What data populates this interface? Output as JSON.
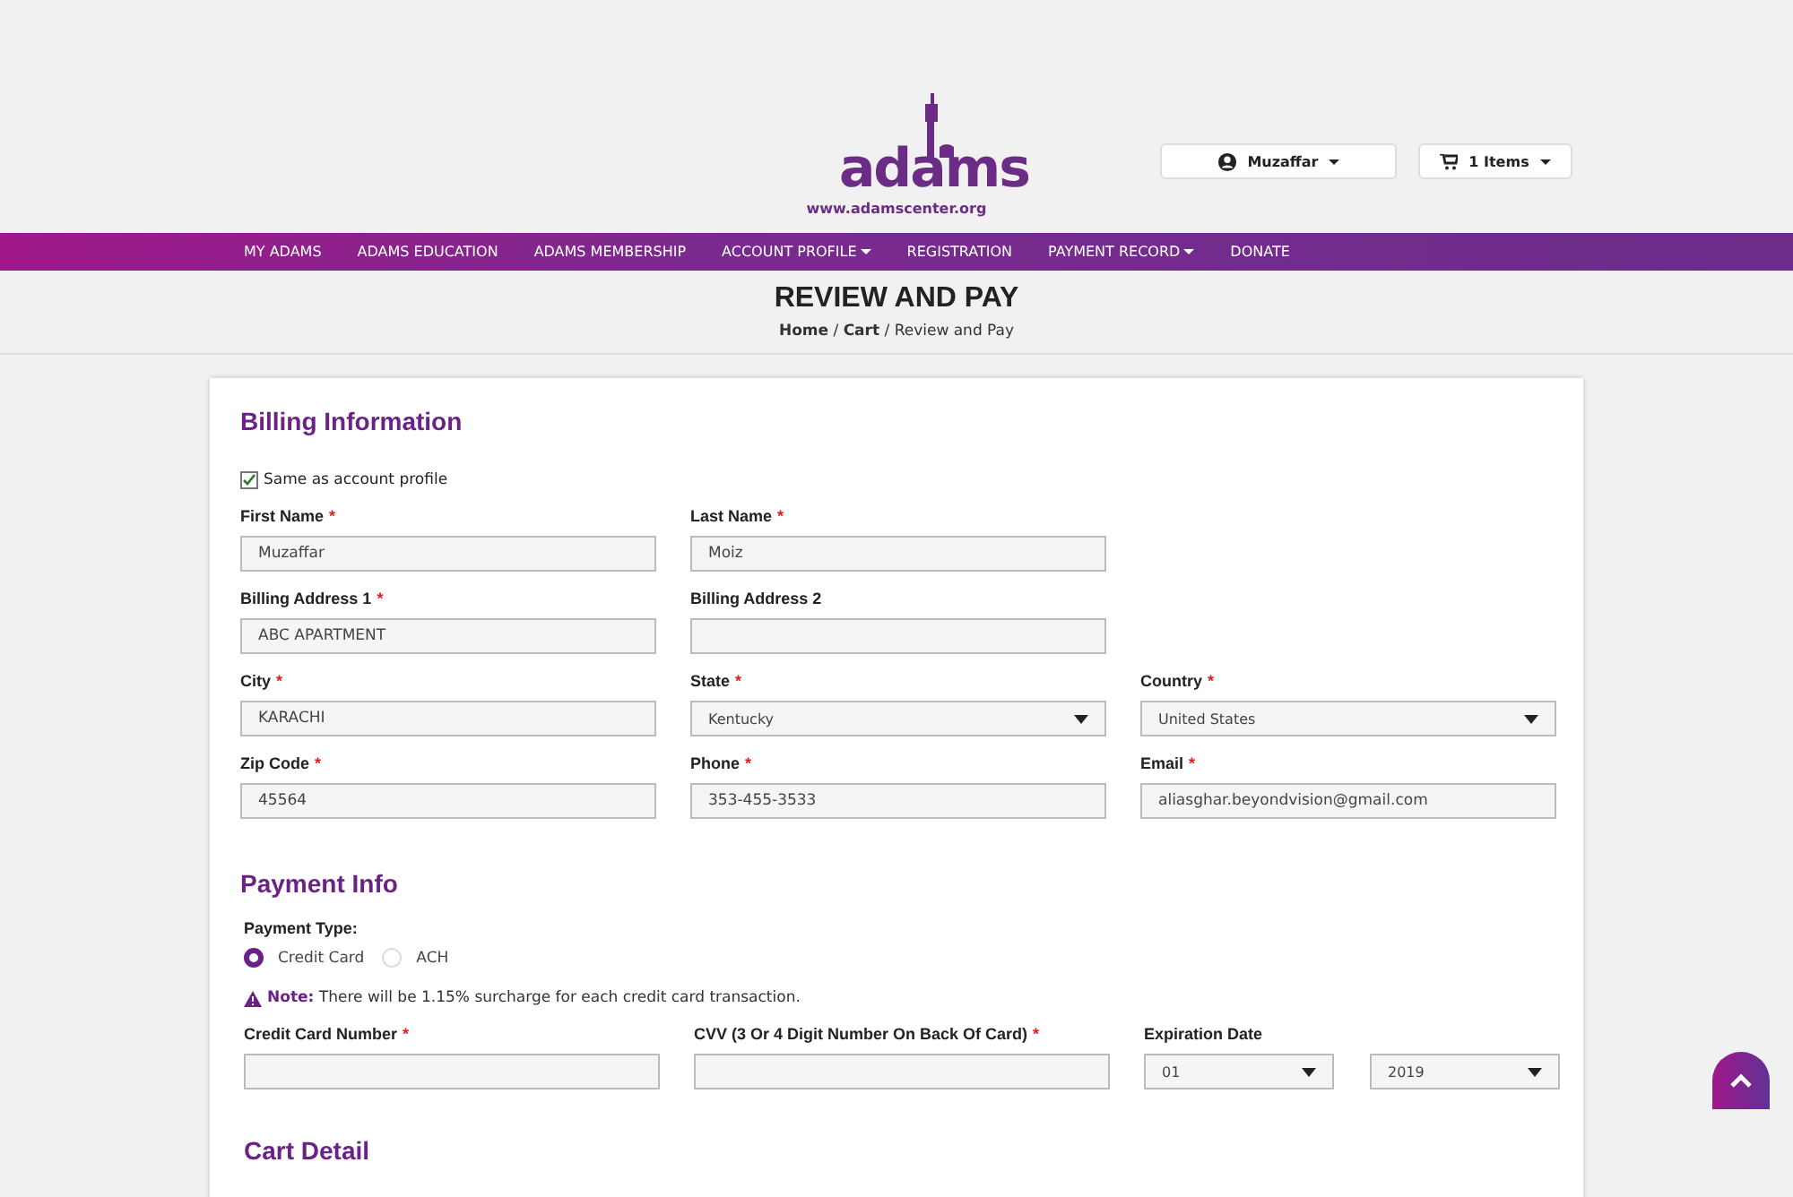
{
  "logo": {
    "name": "adams",
    "url": "www.adamscenter.org"
  },
  "user_menu": {
    "label": "Muzaffar"
  },
  "cart": {
    "label": "1 Items"
  },
  "nav": [
    {
      "label": "MY ADAMS",
      "dropdown": false
    },
    {
      "label": "ADAMS EDUCATION",
      "dropdown": false
    },
    {
      "label": "ADAMS MEMBERSHIP",
      "dropdown": false
    },
    {
      "label": "ACCOUNT PROFILE",
      "dropdown": true
    },
    {
      "label": "REGISTRATION",
      "dropdown": false
    },
    {
      "label": "PAYMENT RECORD",
      "dropdown": true
    },
    {
      "label": "DONATE",
      "dropdown": false
    }
  ],
  "page_title": "REVIEW AND PAY",
  "breadcrumb": "**Home** / **Cart** / Review and Pay",
  "required_mark": "*",
  "billing": {
    "title": "Billing Information",
    "same_as_profile": {
      "label": "Same as account profile",
      "checked": true
    },
    "rows": [
      [
        {
          "label": "First Name",
          "required": true,
          "kind": "input",
          "value": "Muzaffar"
        },
        {
          "label": "Last Name",
          "required": true,
          "kind": "input",
          "value": "Moiz"
        }
      ],
      [
        {
          "label": "Billing Address 1",
          "required": true,
          "kind": "input",
          "value": "ABC APARTMENT"
        },
        {
          "label": "Billing Address 2",
          "required": false,
          "kind": "input"
        }
      ],
      [
        {
          "label": "City",
          "required": true,
          "kind": "input",
          "value": "KARACHI"
        },
        {
          "label": "State",
          "required": true,
          "kind": "select",
          "value": "Kentucky"
        },
        {
          "label": "Country",
          "required": true,
          "kind": "select",
          "value": "United States"
        }
      ],
      [
        {
          "label": "Zip Code",
          "required": true,
          "kind": "input",
          "value": "45564"
        },
        {
          "label": "Phone",
          "required": true,
          "kind": "input",
          "value": "353-455-3533"
        },
        {
          "label": "Email",
          "required": true,
          "kind": "input",
          "value": "aliasghar.beyondvision@gmail.com"
        }
      ]
    ]
  },
  "payment": {
    "title": "Payment Info",
    "type_label": "Payment Type:",
    "options": [
      {
        "label": "Credit Card",
        "selected": true
      },
      {
        "label": "ACH",
        "selected": false
      }
    ],
    "note": {
      "label": "Note:",
      "text": "There will be 1.15% surcharge for each credit card transaction."
    },
    "fields": [
      {
        "label": "Credit Card Number",
        "required": true,
        "kind": "input"
      },
      {
        "label": "CVV (3 Or 4 Digit Number On Back Of Card)",
        "required": true,
        "kind": "input"
      },
      {
        "label": "Expiration Date",
        "required": false,
        "kind": "expiry",
        "month": "01",
        "year": "2019"
      }
    ]
  },
  "cart_detail": {
    "title": "Cart Detail"
  }
}
